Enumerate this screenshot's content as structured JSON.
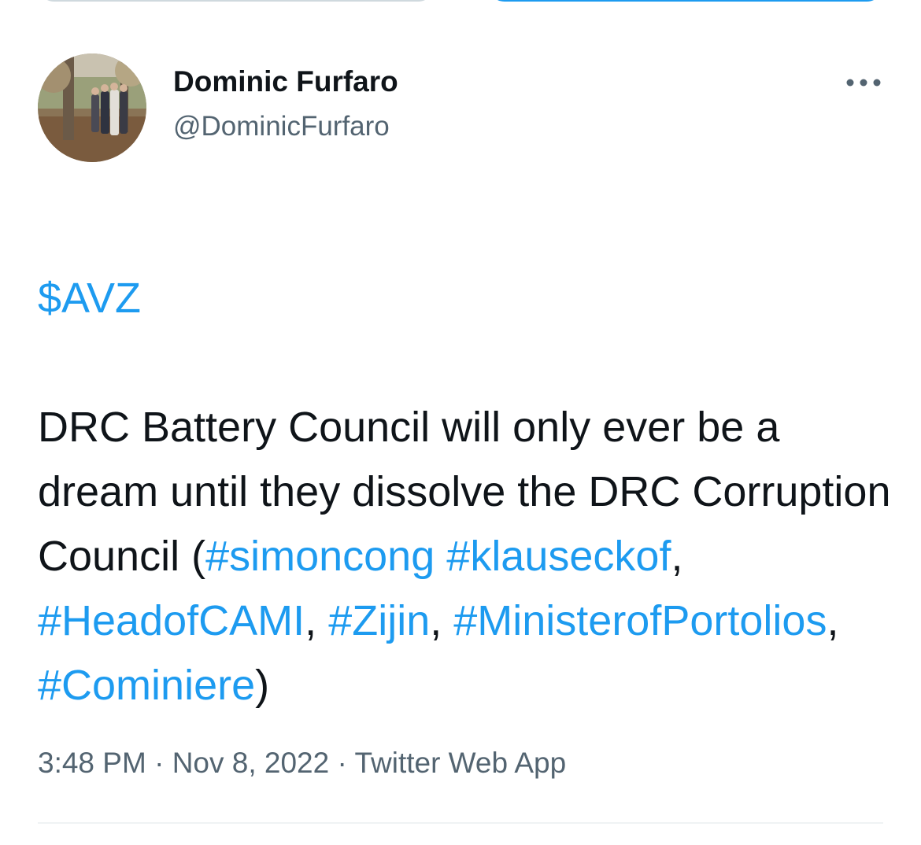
{
  "author": {
    "display_name": "Dominic Furfaro",
    "handle": "@DominicFurfaro"
  },
  "more_icon": "more-horizontal-icon",
  "tweet": {
    "segments": [
      {
        "text": "$AVZ",
        "link": true
      },
      {
        "text": "\n\nDRC Battery Council will only ever be a dream until they dissolve the DRC Corruption Council (",
        "link": false
      },
      {
        "text": "#simoncong",
        "link": true
      },
      {
        "text": " ",
        "link": false
      },
      {
        "text": "#klauseckof",
        "link": true
      },
      {
        "text": ", ",
        "link": false
      },
      {
        "text": "#HeadofCAMI",
        "link": true
      },
      {
        "text": ", ",
        "link": false
      },
      {
        "text": "#Zijin",
        "link": true
      },
      {
        "text": ", ",
        "link": false
      },
      {
        "text": "#MinisterofPortolios",
        "link": true
      },
      {
        "text": ", ",
        "link": false
      },
      {
        "text": "#Cominiere",
        "link": true
      },
      {
        "text": ")",
        "link": false
      }
    ]
  },
  "meta": {
    "time": "3:48 PM",
    "sep1": " · ",
    "date": "Nov 8, 2022",
    "sep2": " · ",
    "source": "Twitter Web App"
  },
  "colors": {
    "link": "#1d9bf0",
    "text": "#0f1419",
    "secondary": "#536471"
  }
}
